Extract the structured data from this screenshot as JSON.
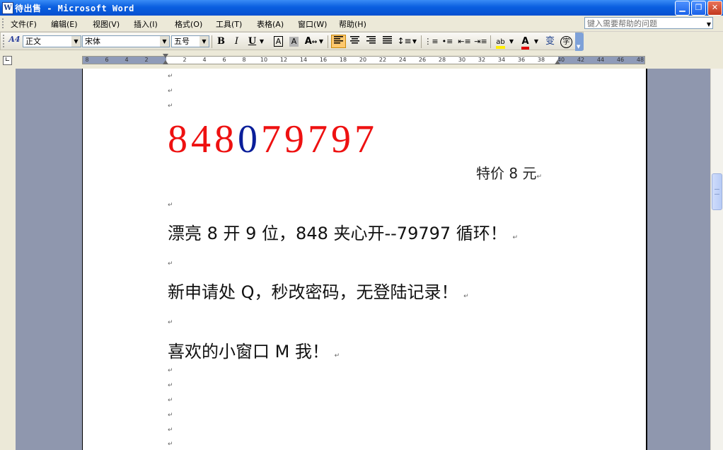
{
  "window": {
    "title": "待出售 - Microsoft Word",
    "app_icon": "W"
  },
  "menu": {
    "items": [
      "文件(F)",
      "编辑(E)",
      "视图(V)",
      "插入(I)",
      "格式(O)",
      "工具(T)",
      "表格(A)",
      "窗口(W)",
      "帮助(H)"
    ],
    "help_placeholder": "键入需要帮助的问题"
  },
  "toolbar": {
    "style_icon": "A4",
    "style": "正文",
    "font": "宋体",
    "size": "五号",
    "bold": "B",
    "italic": "I",
    "underline": "U",
    "char_border": "A",
    "char_shading": "A",
    "scale_icon": "A",
    "highlight_icon": "ab",
    "font_color_icon": "A",
    "phonetic_icon": "变",
    "enclose_icon": "字",
    "alignment_active": "align-left"
  },
  "ruler": {
    "left_labels": [
      "8",
      "6",
      "4",
      "2"
    ],
    "right_labels": [
      "2",
      "4",
      "6",
      "8",
      "10",
      "12",
      "14",
      "16",
      "18",
      "20",
      "22",
      "24",
      "26",
      "28",
      "30",
      "32",
      "34",
      "36",
      "38",
      "40",
      "42",
      "44",
      "46",
      "48"
    ]
  },
  "document": {
    "mark": "↵",
    "big_number": {
      "digits": [
        "8",
        "4",
        "8",
        "0",
        "7",
        "9",
        "7",
        "9",
        "7"
      ],
      "colors": [
        "#ee1111",
        "#ee1111",
        "#ee1111",
        "#0a1e9a",
        "#ee1111",
        "#ee1111",
        "#ee1111",
        "#ee1111",
        "#ee1111"
      ]
    },
    "price": "特价 8 元",
    "line1": "漂亮 8 开 9 位，848 夹心开--79797 循环！",
    "line2": "新申请处 Q，秒改密码，无登陆记录！",
    "line3": "喜欢的小窗口 M 我！"
  }
}
